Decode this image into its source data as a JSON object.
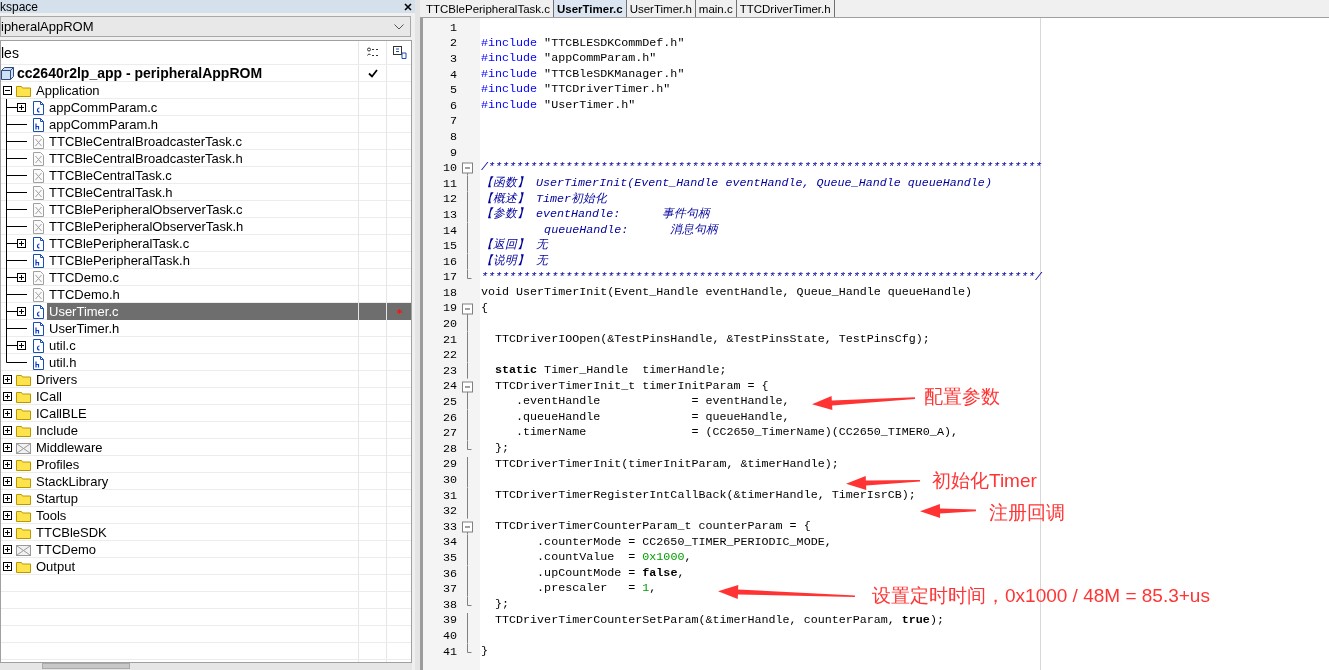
{
  "workspace": {
    "title": "kspace",
    "configuration": "ipheralAppROM",
    "column_header": "les",
    "project": {
      "label": "cc2640r2lp_app - peripheralAppROM",
      "checked": true
    },
    "tree": [
      {
        "label": "Application",
        "kind": "folder",
        "expanded": true,
        "selected": false,
        "children": [
          {
            "label": "appCommParam.c",
            "kind": "c",
            "expanded": false,
            "selected": false,
            "modified": false
          },
          {
            "label": "appCommParam.h",
            "kind": "h",
            "selected": false,
            "modified": false
          },
          {
            "label": "TTCBleCentralBroadcasterTask.c",
            "kind": "excluded",
            "selected": false,
            "modified": false
          },
          {
            "label": "TTCBleCentralBroadcasterTask.h",
            "kind": "excluded",
            "selected": false,
            "modified": false
          },
          {
            "label": "TTCBleCentralTask.c",
            "kind": "excluded",
            "selected": false,
            "modified": false
          },
          {
            "label": "TTCBleCentralTask.h",
            "kind": "excluded",
            "selected": false,
            "modified": false
          },
          {
            "label": "TTCBlePeripheralObserverTask.c",
            "kind": "excluded",
            "selected": false,
            "modified": false
          },
          {
            "label": "TTCBlePeripheralObserverTask.h",
            "kind": "excluded",
            "selected": false,
            "modified": false
          },
          {
            "label": "TTCBlePeripheralTask.c",
            "kind": "c",
            "expanded": false,
            "selected": false,
            "modified": false
          },
          {
            "label": "TTCBlePeripheralTask.h",
            "kind": "h",
            "selected": false,
            "modified": false
          },
          {
            "label": "TTCDemo.c",
            "kind": "excluded",
            "expanded": false,
            "selected": false,
            "modified": false
          },
          {
            "label": "TTCDemo.h",
            "kind": "excluded",
            "selected": false,
            "modified": false
          },
          {
            "label": "UserTimer.c",
            "kind": "c",
            "expanded": false,
            "selected": true,
            "modified": true
          },
          {
            "label": "UserTimer.h",
            "kind": "h",
            "selected": false,
            "modified": false
          },
          {
            "label": "util.c",
            "kind": "c",
            "expanded": false,
            "selected": false,
            "modified": false
          },
          {
            "label": "util.h",
            "kind": "h",
            "selected": false,
            "modified": false
          }
        ]
      },
      {
        "label": "Drivers",
        "kind": "folder",
        "expanded": false,
        "selected": false
      },
      {
        "label": "ICall",
        "kind": "folder",
        "expanded": false,
        "selected": false
      },
      {
        "label": "ICallBLE",
        "kind": "folder",
        "expanded": false,
        "selected": false
      },
      {
        "label": "Include",
        "kind": "folder",
        "expanded": false,
        "selected": false
      },
      {
        "label": "Middleware",
        "kind": "excluded-folder",
        "expanded": false,
        "selected": false
      },
      {
        "label": "Profiles",
        "kind": "folder",
        "expanded": false,
        "selected": false
      },
      {
        "label": "StackLibrary",
        "kind": "folder",
        "expanded": false,
        "selected": false
      },
      {
        "label": "Startup",
        "kind": "folder",
        "expanded": false,
        "selected": false
      },
      {
        "label": "Tools",
        "kind": "folder",
        "expanded": false,
        "selected": false
      },
      {
        "label": "TTCBleSDK",
        "kind": "folder",
        "expanded": false,
        "selected": false
      },
      {
        "label": "TTCDemo",
        "kind": "excluded-folder",
        "expanded": false,
        "selected": false
      },
      {
        "label": "Output",
        "kind": "folder",
        "expanded": false,
        "selected": false
      }
    ]
  },
  "tabs": [
    {
      "label": "TTCBlePeripheralTask.c",
      "selected": false
    },
    {
      "label": "UserTimer.c",
      "selected": true
    },
    {
      "label": "UserTimer.h",
      "selected": false
    },
    {
      "label": "main.c",
      "selected": false
    },
    {
      "label": "TTCDriverTimer.h",
      "selected": false
    }
  ],
  "code_lines": [
    {
      "number": "1",
      "fold_start": false,
      "fold_end": false
    },
    {
      "number": "2",
      "fold_start": false,
      "fold_end": false,
      "tokens": [
        {
          "text": "#include",
          "kind": "keyword"
        },
        {
          "text": " \"TTCBLESDKCommDef.h\"",
          "kind": "plain"
        }
      ]
    },
    {
      "number": "3",
      "fold_start": false,
      "fold_end": false,
      "tokens": [
        {
          "text": "#include",
          "kind": "keyword"
        },
        {
          "text": " \"appCommParam.h\"",
          "kind": "plain"
        }
      ]
    },
    {
      "number": "4",
      "fold_start": false,
      "fold_end": false,
      "tokens": [
        {
          "text": "#include",
          "kind": "keyword"
        },
        {
          "text": " \"TTCBleSDKManager.h\"",
          "kind": "plain"
        }
      ]
    },
    {
      "number": "5",
      "fold_start": false,
      "fold_end": false,
      "tokens": [
        {
          "text": "#include",
          "kind": "keyword"
        },
        {
          "text": " \"TTCDriverTimer.h\"",
          "kind": "plain"
        }
      ]
    },
    {
      "number": "6",
      "fold_start": false,
      "fold_end": false,
      "tokens": [
        {
          "text": "#include",
          "kind": "keyword"
        },
        {
          "text": " \"UserTimer.h\"",
          "kind": "plain"
        }
      ]
    },
    {
      "number": "7",
      "fold_start": false,
      "fold_end": false
    },
    {
      "number": "8",
      "fold_start": false,
      "fold_end": false
    },
    {
      "number": "9",
      "fold_start": false,
      "fold_end": false
    },
    {
      "number": "10",
      "fold_start": true,
      "fold_end": false,
      "tokens": [
        {
          "text": "/*******************************************************************************",
          "kind": "comment"
        }
      ]
    },
    {
      "number": "11",
      "fold_start": false,
      "fold_end": false,
      "tokens": [
        {
          "text": "【函数】 UserTimerInit(Event_Handle eventHandle, Queue_Handle queueHandle)",
          "kind": "comment"
        }
      ]
    },
    {
      "number": "12",
      "fold_start": false,
      "fold_end": false,
      "tokens": [
        {
          "text": "【概述】 Timer初始化",
          "kind": "comment"
        }
      ]
    },
    {
      "number": "13",
      "fold_start": false,
      "fold_end": false,
      "tokens": [
        {
          "text": "【参数】 eventHandle:      事件句柄",
          "kind": "comment"
        }
      ]
    },
    {
      "number": "14",
      "fold_start": false,
      "fold_end": false,
      "tokens": [
        {
          "text": "         queueHandle:      消息句柄",
          "kind": "comment"
        }
      ]
    },
    {
      "number": "15",
      "fold_start": false,
      "fold_end": false,
      "tokens": [
        {
          "text": "【返回】 无",
          "kind": "comment"
        }
      ]
    },
    {
      "number": "16",
      "fold_start": false,
      "fold_end": false,
      "tokens": [
        {
          "text": "【说明】 无",
          "kind": "comment"
        }
      ]
    },
    {
      "number": "17",
      "fold_start": false,
      "fold_end": true,
      "tokens": [
        {
          "text": "*******************************************************************************/",
          "kind": "comment"
        }
      ]
    },
    {
      "number": "18",
      "fold_start": false,
      "fold_end": false,
      "tokens": [
        {
          "text": "void UserTimerInit(Event_Handle eventHandle, Queue_Handle queueHandle)",
          "kind": "plain"
        }
      ]
    },
    {
      "number": "19",
      "fold_start": true,
      "fold_end": false,
      "tokens": [
        {
          "text": "{",
          "kind": "plain"
        }
      ]
    },
    {
      "number": "20",
      "fold_start": false,
      "fold_end": false
    },
    {
      "number": "21",
      "fold_start": false,
      "fold_end": false,
      "tokens": [
        {
          "text": "  TTCDriverIOOpen(&TestPinsHandle, &TestPinsState, TestPinsCfg);",
          "kind": "plain"
        }
      ]
    },
    {
      "number": "22",
      "fold_start": false,
      "fold_end": false
    },
    {
      "number": "23",
      "fold_start": false,
      "fold_end": false,
      "tokens": [
        {
          "text": "  static",
          "kind": "bold"
        },
        {
          "text": " Timer_Handle  timerHandle;",
          "kind": "plain"
        }
      ]
    },
    {
      "number": "24",
      "fold_start": true,
      "fold_end": false,
      "tokens": [
        {
          "text": "  TTCDriverTimerInit_t timerInitParam = {",
          "kind": "plain"
        }
      ]
    },
    {
      "number": "25",
      "fold_start": false,
      "fold_end": false,
      "tokens": [
        {
          "text": "     .eventHandle             = eventHandle,",
          "kind": "plain"
        }
      ]
    },
    {
      "number": "26",
      "fold_start": false,
      "fold_end": false,
      "tokens": [
        {
          "text": "     .queueHandle             = queueHandle,",
          "kind": "plain"
        }
      ]
    },
    {
      "number": "27",
      "fold_start": false,
      "fold_end": false,
      "tokens": [
        {
          "text": "     .timerName               = (CC2650_TimerName)(CC2650_TIMER0_A),",
          "kind": "plain"
        }
      ]
    },
    {
      "number": "28",
      "fold_start": false,
      "fold_end": true,
      "tokens": [
        {
          "text": "  };",
          "kind": "plain"
        }
      ]
    },
    {
      "number": "29",
      "fold_start": false,
      "fold_end": false,
      "tokens": [
        {
          "text": "  TTCDriverTimerInit(timerInitParam, &timerHandle);",
          "kind": "plain"
        }
      ]
    },
    {
      "number": "30",
      "fold_start": false,
      "fold_end": false
    },
    {
      "number": "31",
      "fold_start": false,
      "fold_end": false,
      "tokens": [
        {
          "text": "  TTCDriverTimerRegisterIntCallBack(&timerHandle, TimerIsrCB);",
          "kind": "plain"
        }
      ]
    },
    {
      "number": "32",
      "fold_start": false,
      "fold_end": false
    },
    {
      "number": "33",
      "fold_start": true,
      "fold_end": false,
      "tokens": [
        {
          "text": "  TTCDriverTimerCounterParam_t counterParam = {",
          "kind": "plain"
        }
      ]
    },
    {
      "number": "34",
      "fold_start": false,
      "fold_end": false,
      "tokens": [
        {
          "text": "        .counterMode = CC2650_TIMER_PERIODIC_MODE,",
          "kind": "plain"
        }
      ]
    },
    {
      "number": "35",
      "fold_start": false,
      "fold_end": false,
      "tokens": [
        {
          "text": "        .countValue  = ",
          "kind": "plain"
        },
        {
          "text": "0x1000",
          "kind": "number"
        },
        {
          "text": ",",
          "kind": "plain"
        }
      ]
    },
    {
      "number": "36",
      "fold_start": false,
      "fold_end": false,
      "tokens": [
        {
          "text": "        .upCountMode = ",
          "kind": "plain"
        },
        {
          "text": "false",
          "kind": "bold"
        },
        {
          "text": ",",
          "kind": "plain"
        }
      ]
    },
    {
      "number": "37",
      "fold_start": false,
      "fold_end": false,
      "tokens": [
        {
          "text": "        .prescaler   = ",
          "kind": "plain"
        },
        {
          "text": "1",
          "kind": "number"
        },
        {
          "text": ",",
          "kind": "plain"
        }
      ]
    },
    {
      "number": "38",
      "fold_start": false,
      "fold_end": true,
      "tokens": [
        {
          "text": "  };",
          "kind": "plain"
        }
      ]
    },
    {
      "number": "39",
      "fold_start": false,
      "fold_end": false,
      "tokens": [
        {
          "text": "  TTCDriverTimerCounterSetParam(&timerHandle, counterParam, ",
          "kind": "plain"
        },
        {
          "text": "true",
          "kind": "bold"
        },
        {
          "text": ");",
          "kind": "plain"
        }
      ]
    },
    {
      "number": "40",
      "fold_start": false,
      "fold_end": false
    },
    {
      "number": "41",
      "fold_start": false,
      "fold_end": true,
      "tokens": [
        {
          "text": "}",
          "kind": "plain"
        }
      ]
    }
  ],
  "annotations": [
    {
      "text": "配置参数"
    },
    {
      "text": "初始化Timer"
    },
    {
      "text": "注册回调"
    },
    {
      "text": "设置定时时间，0x1000 / 48M = 85.3+us"
    }
  ]
}
